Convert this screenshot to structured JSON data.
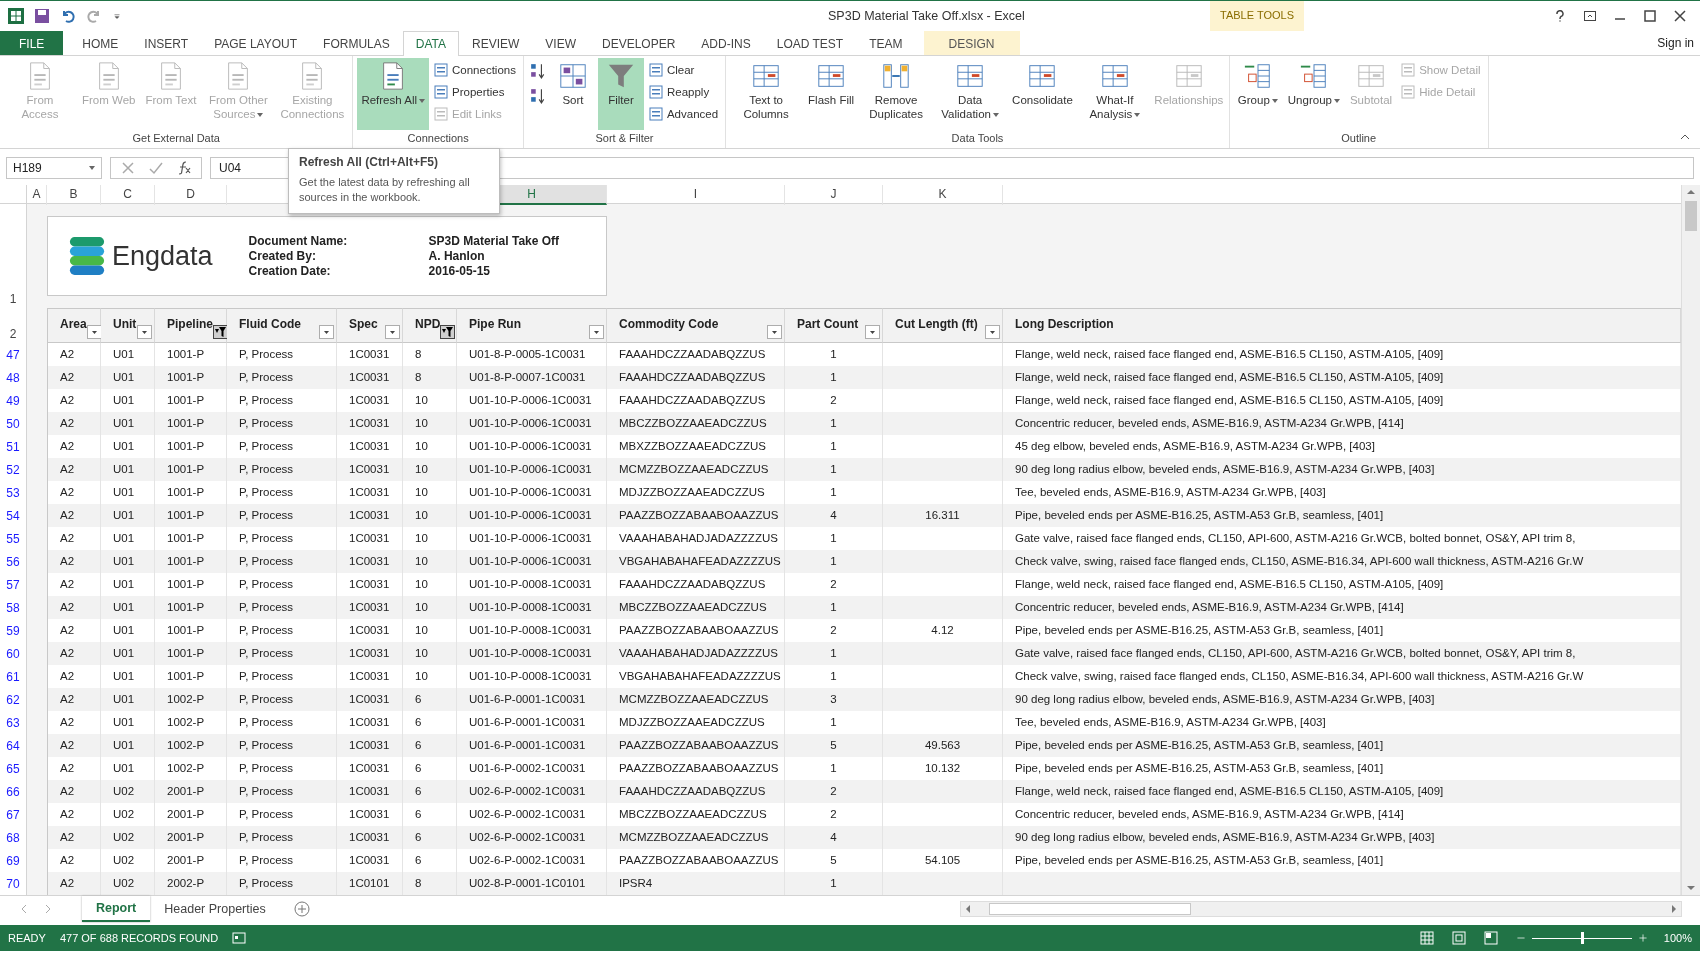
{
  "window": {
    "title": "SP3D Material Take Off.xlsx - Excel",
    "context_label": "TABLE TOOLS",
    "sign_in": "Sign in"
  },
  "menu_tabs": [
    {
      "label": "FILE",
      "kind": "file",
      "selected": false
    },
    {
      "label": "HOME",
      "kind": "tab",
      "selected": false
    },
    {
      "label": "INSERT",
      "kind": "tab",
      "selected": false
    },
    {
      "label": "PAGE LAYOUT",
      "kind": "tab",
      "selected": false
    },
    {
      "label": "FORMULAS",
      "kind": "tab",
      "selected": false
    },
    {
      "label": "DATA",
      "kind": "tab",
      "selected": true
    },
    {
      "label": "REVIEW",
      "kind": "tab",
      "selected": false
    },
    {
      "label": "VIEW",
      "kind": "tab",
      "selected": false
    },
    {
      "label": "DEVELOPER",
      "kind": "tab",
      "selected": false
    },
    {
      "label": "ADD-INS",
      "kind": "tab",
      "selected": false
    },
    {
      "label": "LOAD TEST",
      "kind": "tab",
      "selected": false
    },
    {
      "label": "TEAM",
      "kind": "tab",
      "selected": false
    },
    {
      "label": "DESIGN",
      "kind": "context",
      "selected": false
    }
  ],
  "ribbon": {
    "groups": [
      {
        "label": "Get External Data",
        "buttons": [
          {
            "label": "From Access",
            "kind": "large",
            "disabled": true,
            "selected": false,
            "dropdown": false
          },
          {
            "label": "From Web",
            "kind": "large",
            "disabled": true,
            "selected": false,
            "dropdown": false
          },
          {
            "label": "From Text",
            "kind": "large",
            "disabled": true,
            "selected": false,
            "dropdown": false
          },
          {
            "label": "From Other Sources",
            "kind": "large",
            "disabled": true,
            "selected": false,
            "dropdown": true
          },
          {
            "label": "Existing Connections",
            "kind": "large",
            "disabled": true,
            "selected": false,
            "dropdown": false
          }
        ]
      },
      {
        "label": "Connections",
        "buttons": [
          {
            "label": "Refresh All",
            "kind": "large",
            "disabled": false,
            "selected": true,
            "dropdown": true
          },
          {
            "label": "Connections",
            "kind": "small",
            "disabled": false,
            "selected": false
          },
          {
            "label": "Properties",
            "kind": "small",
            "disabled": false,
            "selected": false
          },
          {
            "label": "Edit Links",
            "kind": "small",
            "disabled": true,
            "selected": false
          }
        ]
      },
      {
        "label": "Sort & Filter",
        "buttons": [
          {
            "kind": "icon"
          },
          {
            "kind": "icon"
          },
          {
            "label": "Sort",
            "kind": "large",
            "disabled": false,
            "selected": false,
            "dropdown": false
          },
          {
            "label": "Filter",
            "kind": "large",
            "disabled": false,
            "selected": true,
            "dropdown": false
          },
          {
            "label": "Clear",
            "kind": "small",
            "disabled": false,
            "selected": false
          },
          {
            "label": "Reapply",
            "kind": "small",
            "disabled": false,
            "selected": false
          },
          {
            "label": "Advanced",
            "kind": "small",
            "disabled": false,
            "selected": false
          }
        ]
      },
      {
        "label": "Data Tools",
        "buttons": [
          {
            "label": "Text to Columns",
            "kind": "large",
            "disabled": false,
            "selected": false,
            "dropdown": false
          },
          {
            "label": "Flash Fill",
            "kind": "large",
            "disabled": false,
            "selected": false,
            "dropdown": false
          },
          {
            "label": "Remove Duplicates",
            "kind": "large",
            "disabled": false,
            "selected": false,
            "dropdown": false
          },
          {
            "label": "Data Validation",
            "kind": "large",
            "disabled": false,
            "selected": false,
            "dropdown": true
          },
          {
            "label": "Consolidate",
            "kind": "large",
            "disabled": false,
            "selected": false,
            "dropdown": false
          },
          {
            "label": "What-If Analysis",
            "kind": "large",
            "disabled": false,
            "selected": false,
            "dropdown": true
          },
          {
            "label": "Relationships",
            "kind": "large",
            "disabled": true,
            "selected": false,
            "dropdown": false
          }
        ]
      },
      {
        "label": "Outline",
        "buttons": [
          {
            "label": "Group",
            "kind": "large",
            "disabled": false,
            "selected": false,
            "dropdown": true
          },
          {
            "label": "Ungroup",
            "kind": "large",
            "disabled": false,
            "selected": false,
            "dropdown": true
          },
          {
            "label": "Subtotal",
            "kind": "large",
            "disabled": true,
            "selected": false,
            "dropdown": false
          },
          {
            "label": "Show Detail",
            "kind": "small",
            "disabled": true,
            "selected": false
          },
          {
            "label": "Hide Detail",
            "kind": "small",
            "disabled": true,
            "selected": false
          }
        ]
      }
    ]
  },
  "formula_bar": {
    "name_box": "H189",
    "value": "U04"
  },
  "tooltip": {
    "title": "Refresh All (Ctrl+Alt+F5)",
    "text": "Get the latest data by refreshing all sources in the workbook."
  },
  "column_headers": [
    {
      "label": "A",
      "selected": false
    },
    {
      "label": "B",
      "selected": false
    },
    {
      "label": "C",
      "selected": false
    },
    {
      "label": "D",
      "selected": false
    },
    {
      "label": "H",
      "selected": true
    },
    {
      "label": "I",
      "selected": false
    },
    {
      "label": "J",
      "selected": false
    },
    {
      "label": "K",
      "selected": false
    }
  ],
  "header_card": {
    "brand": "Engdata",
    "row_labels": [
      "1",
      "2"
    ],
    "fields": [
      {
        "label": "Document Name:",
        "value": "SP3D Material Take Off"
      },
      {
        "label": "Created By:",
        "value": "A. Hanlon"
      },
      {
        "label": "Creation Date:",
        "value": "2016-05-15"
      }
    ]
  },
  "table": {
    "columns": [
      {
        "label": "Area",
        "filter_button": true,
        "filtered": false
      },
      {
        "label": "Unit",
        "filter_button": true,
        "filtered": false
      },
      {
        "label": "Pipeline",
        "filter_button": true,
        "filtered": true
      },
      {
        "label": "Fluid Code",
        "filter_button": true,
        "filtered": false
      },
      {
        "label": "Spec",
        "filter_button": true,
        "filtered": false
      },
      {
        "label": "NPD",
        "filter_button": true,
        "filtered": true
      },
      {
        "label": "Pipe Run",
        "filter_button": true,
        "filtered": false
      },
      {
        "label": "Commodity Code",
        "filter_button": true,
        "filtered": false
      },
      {
        "label": "Part Count",
        "filter_button": true,
        "filtered": false
      },
      {
        "label": "Cut Length (ft)",
        "filter_button": true,
        "filtered": false
      },
      {
        "label": "Long Description",
        "filter_button": false
      }
    ],
    "rows": [
      {
        "row": "47",
        "area": "A2",
        "unit": "U01",
        "pipeline": "1001-P",
        "fluid_code": "P, Process",
        "spec": "1C0031",
        "npd": "8",
        "pipe_run": "U01-8-P-0005-1C0031",
        "commodity_code": "FAAAHDCZZAADABQZZUS",
        "part_count": "1",
        "long_description": "Flange, weld neck, raised face flanged end, ASME-B16.5 CL150, ASTM-A105, [409]"
      },
      {
        "row": "48",
        "area": "A2",
        "unit": "U01",
        "pipeline": "1001-P",
        "fluid_code": "P, Process",
        "spec": "1C0031",
        "npd": "8",
        "pipe_run": "U01-8-P-0007-1C0031",
        "commodity_code": "FAAAHDCZZAADABQZZUS",
        "part_count": "1",
        "long_description": "Flange, weld neck, raised face flanged end, ASME-B16.5 CL150, ASTM-A105, [409]"
      },
      {
        "row": "49",
        "area": "A2",
        "unit": "U01",
        "pipeline": "1001-P",
        "fluid_code": "P, Process",
        "spec": "1C0031",
        "npd": "10",
        "pipe_run": "U01-10-P-0006-1C0031",
        "commodity_code": "FAAAHDCZZAADABQZZUS",
        "part_count": "2",
        "long_description": "Flange, weld neck, raised face flanged end, ASME-B16.5 CL150, ASTM-A105, [409]"
      },
      {
        "row": "50",
        "area": "A2",
        "unit": "U01",
        "pipeline": "1001-P",
        "fluid_code": "P, Process",
        "spec": "1C0031",
        "npd": "10",
        "pipe_run": "U01-10-P-0006-1C0031",
        "commodity_code": "MBCZZBOZZAAEADCZZUS",
        "part_count": "1",
        "long_description": "Concentric reducer, beveled ends, ASME-B16.9, ASTM-A234 Gr.WPB, [414]"
      },
      {
        "row": "51",
        "area": "A2",
        "unit": "U01",
        "pipeline": "1001-P",
        "fluid_code": "P, Process",
        "spec": "1C0031",
        "npd": "10",
        "pipe_run": "U01-10-P-0006-1C0031",
        "commodity_code": "MBXZZBOZZAAEADCZZUS",
        "part_count": "1",
        "long_description": "45 deg elbow, beveled ends, ASME-B16.9, ASTM-A234 Gr.WPB, [403]"
      },
      {
        "row": "52",
        "area": "A2",
        "unit": "U01",
        "pipeline": "1001-P",
        "fluid_code": "P, Process",
        "spec": "1C0031",
        "npd": "10",
        "pipe_run": "U01-10-P-0006-1C0031",
        "commodity_code": "MCMZZBOZZAAEADCZZUS",
        "part_count": "1",
        "long_description": "90 deg long radius elbow, beveled ends, ASME-B16.9, ASTM-A234 Gr.WPB, [403]"
      },
      {
        "row": "53",
        "area": "A2",
        "unit": "U01",
        "pipeline": "1001-P",
        "fluid_code": "P, Process",
        "spec": "1C0031",
        "npd": "10",
        "pipe_run": "U01-10-P-0006-1C0031",
        "commodity_code": "MDJZZBOZZAAEADCZZUS",
        "part_count": "1",
        "long_description": "Tee, beveled ends, ASME-B16.9, ASTM-A234 Gr.WPB, [403]"
      },
      {
        "row": "54",
        "area": "A2",
        "unit": "U01",
        "pipeline": "1001-P",
        "fluid_code": "P, Process",
        "spec": "1C0031",
        "npd": "10",
        "pipe_run": "U01-10-P-0006-1C0031",
        "commodity_code": "PAAZZBOZZABAABOAAZZUS",
        "part_count": "4",
        "cut_length": "16.311",
        "long_description": "Pipe, beveled ends per ASME-B16.25, ASTM-A53 Gr.B, seamless, [401]"
      },
      {
        "row": "55",
        "area": "A2",
        "unit": "U01",
        "pipeline": "1001-P",
        "fluid_code": "P, Process",
        "spec": "1C0031",
        "npd": "10",
        "pipe_run": "U01-10-P-0006-1C0031",
        "commodity_code": "VAAAHABAHADJADAZZZZUS",
        "part_count": "1",
        "long_description": "Gate valve, raised face flanged ends, CL150, API-600, ASTM-A216 Gr.WCB, bolted bonnet, OS&Y, API trim 8,"
      },
      {
        "row": "56",
        "area": "A2",
        "unit": "U01",
        "pipeline": "1001-P",
        "fluid_code": "P, Process",
        "spec": "1C0031",
        "npd": "10",
        "pipe_run": "U01-10-P-0006-1C0031",
        "commodity_code": "VBGAHABAHAFEADAZZZZUS",
        "part_count": "1",
        "long_description": "Check valve, swing, raised face flanged ends, CL150, ASME-B16.34, API-600 wall thickness, ASTM-A216 Gr.W"
      },
      {
        "row": "57",
        "area": "A2",
        "unit": "U01",
        "pipeline": "1001-P",
        "fluid_code": "P, Process",
        "spec": "1C0031",
        "npd": "10",
        "pipe_run": "U01-10-P-0008-1C0031",
        "commodity_code": "FAAAHDCZZAADABQZZUS",
        "part_count": "2",
        "long_description": "Flange, weld neck, raised face flanged end, ASME-B16.5 CL150, ASTM-A105, [409]"
      },
      {
        "row": "58",
        "area": "A2",
        "unit": "U01",
        "pipeline": "1001-P",
        "fluid_code": "P, Process",
        "spec": "1C0031",
        "npd": "10",
        "pipe_run": "U01-10-P-0008-1C0031",
        "commodity_code": "MBCZZBOZZAAEADCZZUS",
        "part_count": "1",
        "long_description": "Concentric reducer, beveled ends, ASME-B16.9, ASTM-A234 Gr.WPB, [414]"
      },
      {
        "row": "59",
        "area": "A2",
        "unit": "U01",
        "pipeline": "1001-P",
        "fluid_code": "P, Process",
        "spec": "1C0031",
        "npd": "10",
        "pipe_run": "U01-10-P-0008-1C0031",
        "commodity_code": "PAAZZBOZZABAABOAAZZUS",
        "part_count": "2",
        "cut_length": "4.12",
        "long_description": "Pipe, beveled ends per ASME-B16.25, ASTM-A53 Gr.B, seamless, [401]"
      },
      {
        "row": "60",
        "area": "A2",
        "unit": "U01",
        "pipeline": "1001-P",
        "fluid_code": "P, Process",
        "spec": "1C0031",
        "npd": "10",
        "pipe_run": "U01-10-P-0008-1C0031",
        "commodity_code": "VAAAHABAHADJADAZZZZUS",
        "part_count": "1",
        "long_description": "Gate valve, raised face flanged ends, CL150, API-600, ASTM-A216 Gr.WCB, bolted bonnet, OS&Y, API trim 8,"
      },
      {
        "row": "61",
        "area": "A2",
        "unit": "U01",
        "pipeline": "1001-P",
        "fluid_code": "P, Process",
        "spec": "1C0031",
        "npd": "10",
        "pipe_run": "U01-10-P-0008-1C0031",
        "commodity_code": "VBGAHABAHAFEADAZZZZUS",
        "part_count": "1",
        "long_description": "Check valve, swing, raised face flanged ends, CL150, ASME-B16.34, API-600 wall thickness, ASTM-A216 Gr.W"
      },
      {
        "row": "62",
        "area": "A2",
        "unit": "U01",
        "pipeline": "1002-P",
        "fluid_code": "P, Process",
        "spec": "1C0031",
        "npd": "6",
        "pipe_run": "U01-6-P-0001-1C0031",
        "commodity_code": "MCMZZBOZZAAEADCZZUS",
        "part_count": "3",
        "long_description": "90 deg long radius elbow, beveled ends, ASME-B16.9, ASTM-A234 Gr.WPB, [403]"
      },
      {
        "row": "63",
        "area": "A2",
        "unit": "U01",
        "pipeline": "1002-P",
        "fluid_code": "P, Process",
        "spec": "1C0031",
        "npd": "6",
        "pipe_run": "U01-6-P-0001-1C0031",
        "commodity_code": "MDJZZBOZZAAEADCZZUS",
        "part_count": "1",
        "long_description": "Tee, beveled ends, ASME-B16.9, ASTM-A234 Gr.WPB, [403]"
      },
      {
        "row": "64",
        "area": "A2",
        "unit": "U01",
        "pipeline": "1002-P",
        "fluid_code": "P, Process",
        "spec": "1C0031",
        "npd": "6",
        "pipe_run": "U01-6-P-0001-1C0031",
        "commodity_code": "PAAZZBOZZABAABOAAZZUS",
        "part_count": "5",
        "cut_length": "49.563",
        "long_description": "Pipe, beveled ends per ASME-B16.25, ASTM-A53 Gr.B, seamless, [401]"
      },
      {
        "row": "65",
        "area": "A2",
        "unit": "U01",
        "pipeline": "1002-P",
        "fluid_code": "P, Process",
        "spec": "1C0031",
        "npd": "6",
        "pipe_run": "U01-6-P-0002-1C0031",
        "commodity_code": "PAAZZBOZZABAABOAAZZUS",
        "part_count": "1",
        "cut_length": "10.132",
        "long_description": "Pipe, beveled ends per ASME-B16.25, ASTM-A53 Gr.B, seamless, [401]"
      },
      {
        "row": "66",
        "area": "A2",
        "unit": "U02",
        "pipeline": "2001-P",
        "fluid_code": "P, Process",
        "spec": "1C0031",
        "npd": "6",
        "pipe_run": "U02-6-P-0002-1C0031",
        "commodity_code": "FAAAHDCZZAADABQZZUS",
        "part_count": "2",
        "long_description": "Flange, weld neck, raised face flanged end, ASME-B16.5 CL150, ASTM-A105, [409]"
      },
      {
        "row": "67",
        "area": "A2",
        "unit": "U02",
        "pipeline": "2001-P",
        "fluid_code": "P, Process",
        "spec": "1C0031",
        "npd": "6",
        "pipe_run": "U02-6-P-0002-1C0031",
        "commodity_code": "MBCZZBOZZAAEADCZZUS",
        "part_count": "2",
        "long_description": "Concentric reducer, beveled ends, ASME-B16.9, ASTM-A234 Gr.WPB, [414]"
      },
      {
        "row": "68",
        "area": "A2",
        "unit": "U02",
        "pipeline": "2001-P",
        "fluid_code": "P, Process",
        "spec": "1C0031",
        "npd": "6",
        "pipe_run": "U02-6-P-0002-1C0031",
        "commodity_code": "MCMZZBOZZAAEADCZZUS",
        "part_count": "4",
        "long_description": "90 deg long radius elbow, beveled ends, ASME-B16.9, ASTM-A234 Gr.WPB, [403]"
      },
      {
        "row": "69",
        "area": "A2",
        "unit": "U02",
        "pipeline": "2001-P",
        "fluid_code": "P, Process",
        "spec": "1C0031",
        "npd": "6",
        "pipe_run": "U02-6-P-0002-1C0031",
        "commodity_code": "PAAZZBOZZABAABOAAZZUS",
        "part_count": "5",
        "cut_length": "54.105",
        "long_description": "Pipe, beveled ends per ASME-B16.25, ASTM-A53 Gr.B, seamless, [401]"
      },
      {
        "row": "70",
        "area": "A2",
        "unit": "U02",
        "pipeline": "2002-P",
        "fluid_code": "P, Process",
        "spec": "1C0101",
        "npd": "8",
        "pipe_run": "U02-8-P-0001-1C0101",
        "commodity_code": "IPSR4",
        "part_count": "1"
      }
    ]
  },
  "sheet_tabs": [
    {
      "label": "Report",
      "selected": true
    },
    {
      "label": "Header Properties",
      "selected": false
    }
  ],
  "status_bar": {
    "mode": "READY",
    "records": "477 OF 688 RECORDS FOUND",
    "zoom": {
      "level": 0.5,
      "reading": "100%"
    }
  }
}
